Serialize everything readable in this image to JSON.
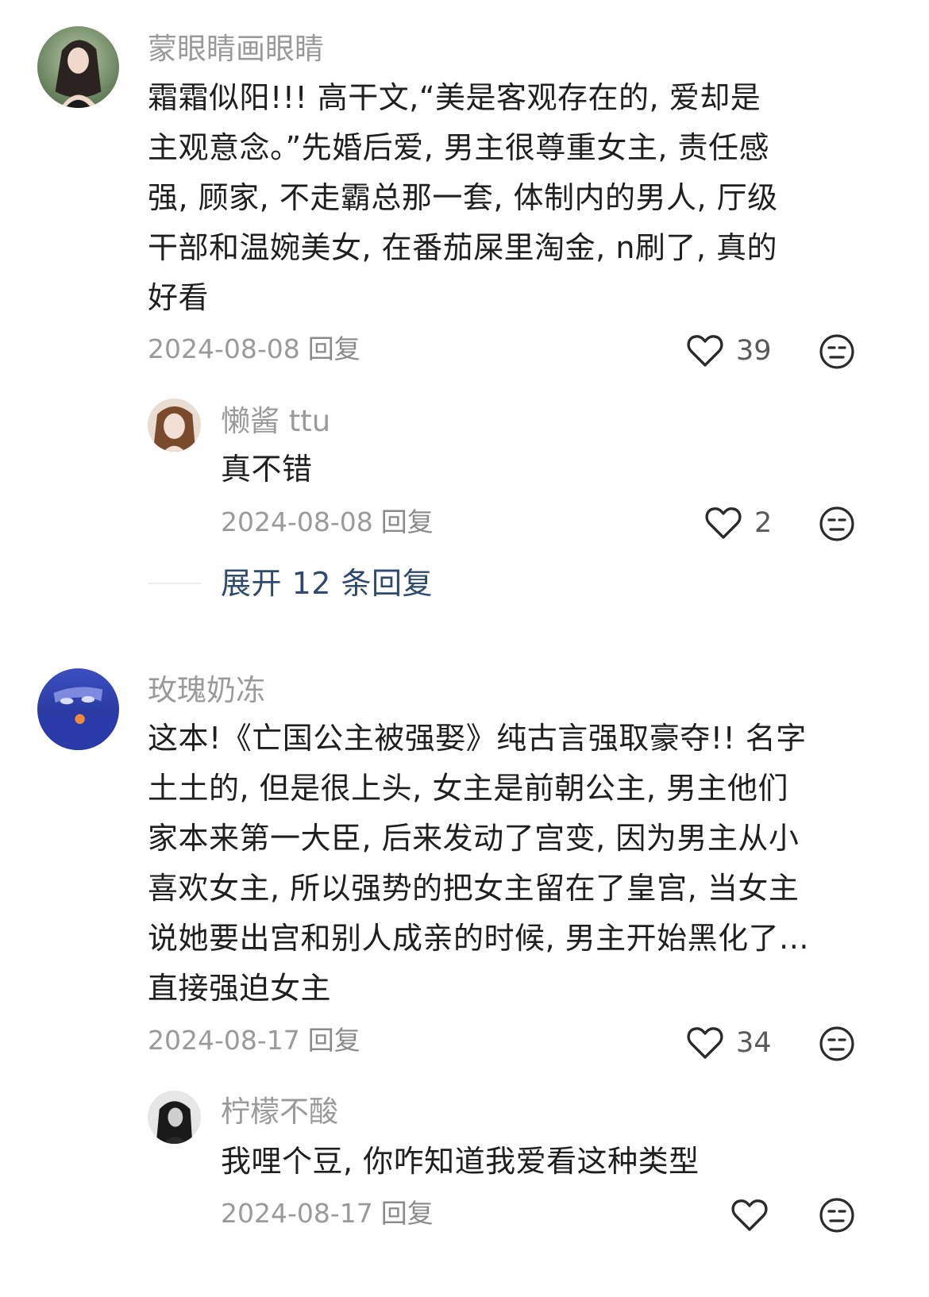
{
  "comments": [
    {
      "username": "蒙眼睛画眼睛",
      "lines": [
        "霜霜似阳!!! 高干文,“美是客观存在的, 爱却是",
        "主观意念。”先婚后爱, 男主很尊重女主, 责任感",
        "强, 顾家, 不走霸总那一套, 体制内的男人, 厅级",
        "干部和温婉美女, 在番茄屎里淘金, n刷了, 真的",
        "好看"
      ],
      "date": "2024-08-08",
      "reply_label": "回复",
      "likes": "39",
      "reply": {
        "username": "懒酱 ttu",
        "text": "真不错",
        "date": "2024-08-08",
        "reply_label": "回复",
        "likes": "2"
      },
      "expand_label": "展开 12 条回复"
    },
    {
      "username": "玫瑰奶冻",
      "lines": [
        "这本!《亡国公主被强娶》纯古言强取豪夺!! 名字",
        "土土的, 但是很上头, 女主是前朝公主, 男主他们",
        "家本来第一大臣, 后来发动了宫变, 因为男主从小",
        "喜欢女主, 所以强势的把女主留在了皇宫, 当女主",
        "说她要出宫和别人成亲的时候, 男主开始黑化了...",
        "直接强迫女主"
      ],
      "date": "2024-08-17",
      "reply_label": "回复",
      "likes": "34",
      "reply": {
        "username": "柠檬不酸",
        "text": "我哩个豆, 你咋知道我爱看这种类型",
        "date": "2024-08-17",
        "reply_label": "回复",
        "likes": ""
      }
    }
  ],
  "icons": {
    "like": "heart-outline-icon",
    "dislike": "unamused-face-icon"
  },
  "colors": {
    "username": "#9a9a9a",
    "text": "#1f1f1f",
    "meta": "#9a9a9a",
    "expand": "#2f4a6d",
    "icon": "#2b2b2b"
  }
}
